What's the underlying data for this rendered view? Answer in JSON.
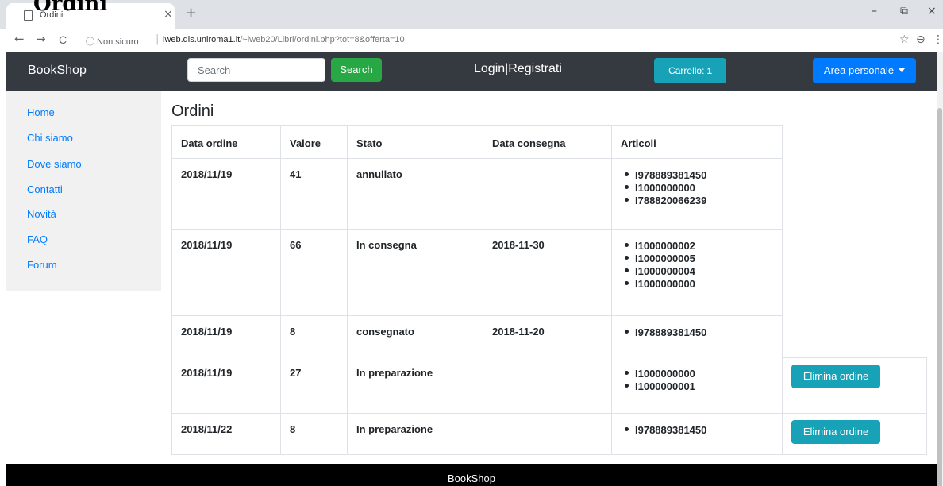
{
  "window": {
    "overlay_title": "Ordini",
    "tab_title": "Ordini",
    "tab_close": "×",
    "new_tab": "+",
    "controls": {
      "minimize": "–",
      "restore": "⧉",
      "close": "×"
    }
  },
  "addressbar": {
    "back": "←",
    "forward": "→",
    "reload": "C",
    "security_label": "ⓘ Non sicuro",
    "separator": "|",
    "url_host": "lweb.dis.uniroma1.it",
    "url_path": "/~lweb20/Libri/ordini.php?tot=8&offerta=10",
    "star": "☆",
    "profile": "⊖",
    "menu": "⋮"
  },
  "navbar": {
    "brand": "BookShop",
    "search_placeholder": "Search",
    "search_button": "Search",
    "login": "Login|Registrati",
    "cart_label": "Carrello:",
    "cart_count": "1",
    "area_label": "Area personale"
  },
  "sidebar": {
    "items": [
      {
        "label": "Home"
      },
      {
        "label": "Chi siamo"
      },
      {
        "label": "Dove siamo"
      },
      {
        "label": "Contatti"
      },
      {
        "label": "Novità"
      },
      {
        "label": "FAQ"
      },
      {
        "label": "Forum"
      }
    ]
  },
  "main": {
    "title": "Ordini",
    "headers": [
      "Data ordine",
      "Valore",
      "Stato",
      "Data consegna",
      "Articoli"
    ],
    "rows": [
      {
        "date": "2018/11/19",
        "value": "41",
        "status": "annullato",
        "delivery": "",
        "items": [
          "I978889381450",
          "I1000000000",
          "I788820066239"
        ],
        "delete": ""
      },
      {
        "date": "2018/11/19",
        "value": "66",
        "status": "In consegna",
        "delivery": "2018-11-30",
        "items": [
          "I1000000002",
          "I1000000005",
          "I1000000004",
          "I1000000000"
        ],
        "delete": ""
      },
      {
        "date": "2018/11/19",
        "value": "8",
        "status": "consegnato",
        "delivery": "2018-11-20",
        "items": [
          "I978889381450"
        ],
        "delete": ""
      },
      {
        "date": "2018/11/19",
        "value": "27",
        "status": "In preparazione",
        "delivery": "",
        "items": [
          "I1000000000",
          "I1000000001"
        ],
        "delete": "Elimina ordine"
      },
      {
        "date": "2018/11/22",
        "value": "8",
        "status": "In preparazione",
        "delivery": "",
        "items": [
          "I978889381450"
        ],
        "delete": "Elimina ordine"
      }
    ]
  },
  "footer": {
    "text": "BookShop"
  }
}
